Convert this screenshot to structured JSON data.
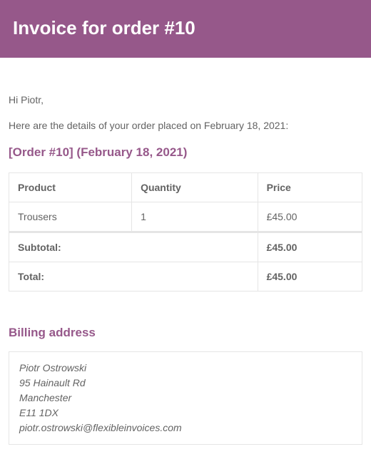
{
  "header": {
    "title": "Invoice for order #10"
  },
  "greeting": "Hi Piotr,",
  "intro": "Here are the details of your order placed on February 18, 2021:",
  "order_heading": "[Order #10] (February 18, 2021)",
  "table": {
    "headers": {
      "product": "Product",
      "quantity": "Quantity",
      "price": "Price"
    },
    "rows": [
      {
        "product": "Trousers",
        "quantity": "1",
        "price": "£45.00"
      }
    ],
    "subtotal_label": "Subtotal:",
    "subtotal_value": "£45.00",
    "total_label": "Total:",
    "total_value": "£45.00"
  },
  "billing": {
    "heading": "Billing address",
    "name": "Piotr Ostrowski",
    "street": "95 Hainault Rd",
    "city": "Manchester",
    "postcode": "E11 1DX",
    "email": "piotr.ostrowski@flexibleinvoices.com"
  }
}
